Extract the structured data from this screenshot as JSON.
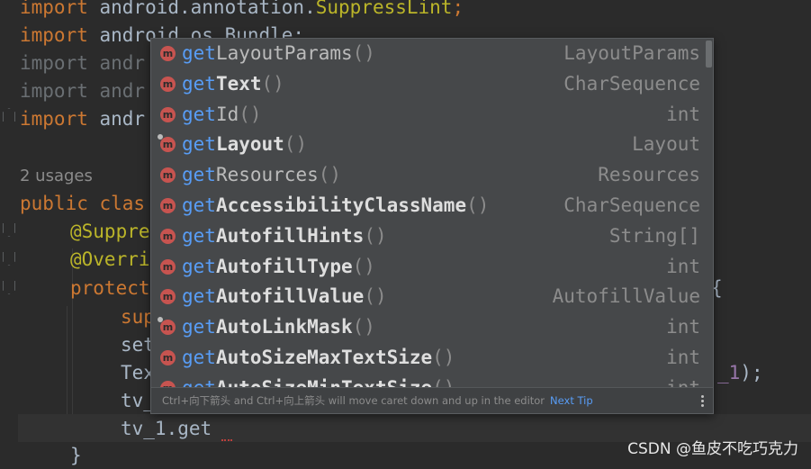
{
  "code": {
    "line1": {
      "kw": "import",
      "text": " android.annotation.",
      "cls": "SuppressLint",
      "end": ";"
    },
    "line2": {
      "kw": "import",
      "text": " android.os.Bundle;"
    },
    "line3": {
      "kw": "import",
      "text": " andr"
    },
    "line4": {
      "kw": "import",
      "text": " andr"
    },
    "line5": {
      "kw": "import",
      "text": " andr"
    },
    "usages": "2 usages",
    "line6": {
      "kw": "public",
      "text": " clas"
    },
    "line7": {
      "ann": "@Suppre"
    },
    "line8": {
      "ann": "@Overri"
    },
    "line9": {
      "kw": "protect",
      "right": "{"
    },
    "line10": {
      "text": "sup"
    },
    "line11": {
      "text": "set"
    },
    "line12": {
      "text": "Tex",
      "right_a": "_1",
      "right_b": ");"
    },
    "line13": {
      "text": "tv_"
    },
    "line14": {
      "text": "tv_1.get"
    },
    "line15": {
      "kw": "}"
    }
  },
  "completion": {
    "prefix": "get",
    "items": [
      {
        "rest": "LayoutParams",
        "parens": "()",
        "type": "LayoutParams",
        "bold": false,
        "badge": "m",
        "tick": false
      },
      {
        "rest": "Text",
        "parens": "()",
        "type": "CharSequence",
        "bold": true,
        "badge": "m",
        "tick": false
      },
      {
        "rest": "Id",
        "parens": "()",
        "type": "int",
        "bold": false,
        "badge": "m",
        "tick": false
      },
      {
        "rest": "Layout",
        "parens": "()",
        "type": "Layout",
        "bold": true,
        "badge": "m",
        "tick": true
      },
      {
        "rest": "Resources",
        "parens": "()",
        "type": "Resources",
        "bold": false,
        "badge": "m",
        "tick": false
      },
      {
        "rest": "AccessibilityClassName",
        "parens": "()",
        "type": "CharSequence",
        "bold": true,
        "badge": "m",
        "tick": false
      },
      {
        "rest": "AutofillHints",
        "parens": "()",
        "type": "String[]",
        "bold": true,
        "badge": "m",
        "tick": false
      },
      {
        "rest": "AutofillType",
        "parens": "()",
        "type": "int",
        "bold": true,
        "badge": "m",
        "tick": false
      },
      {
        "rest": "AutofillValue",
        "parens": "()",
        "type": "AutofillValue",
        "bold": true,
        "badge": "m",
        "tick": false
      },
      {
        "rest": "AutoLinkMask",
        "parens": "()",
        "type": "int",
        "bold": true,
        "badge": "m",
        "tick": true
      },
      {
        "rest": "AutoSizeMaxTextSize",
        "parens": "()",
        "type": "int",
        "bold": true,
        "badge": "m",
        "tick": false
      },
      {
        "rest": "AutoSizeMinTextSize",
        "parens": "()",
        "type": "int",
        "bold": true,
        "badge": "m",
        "tick": false
      }
    ],
    "footer_text": "Ctrl+向下箭头 and Ctrl+向上箭头 will move caret down and up in the editor",
    "next_tip": "Next Tip"
  },
  "watermark": "CSDN @鱼皮不吃巧克力",
  "colors": {
    "background": "#2b2b2b",
    "popup": "#46484a",
    "keyword": "#cc7832",
    "annotation": "#bbb529",
    "match": "#589df6",
    "badge": "#c75450"
  }
}
